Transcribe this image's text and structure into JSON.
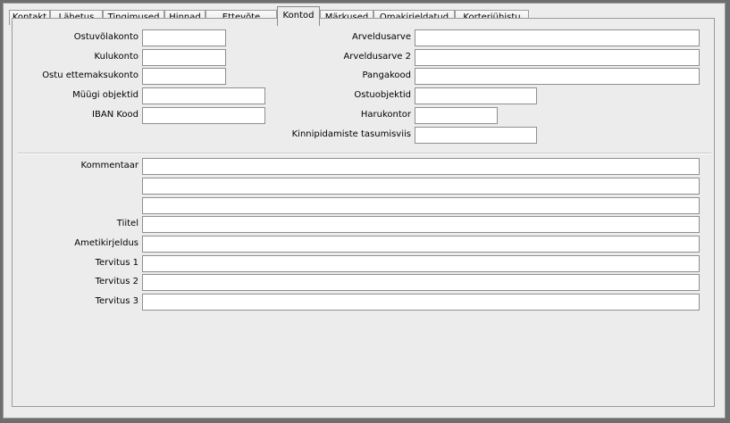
{
  "tabs": [
    {
      "label": "Kontakt"
    },
    {
      "label": "Lähetus"
    },
    {
      "label": "Tingimused"
    },
    {
      "label": "Hinnad"
    },
    {
      "label": "Ettevõte"
    },
    {
      "label": "Kontod",
      "active": true
    },
    {
      "label": "Märkused"
    },
    {
      "label": "Omakirjeldatud"
    },
    {
      "label": "Korteriühistu"
    }
  ],
  "left_fields": [
    {
      "label": "Ostuvõlakonto",
      "value": ""
    },
    {
      "label": "Kulukonto",
      "value": ""
    },
    {
      "label": "Ostu ettemaksukonto",
      "value": ""
    },
    {
      "label": "Müügi objektid",
      "value": ""
    },
    {
      "label": "IBAN Kood",
      "value": ""
    }
  ],
  "right_fields": [
    {
      "label": "Arveldusarve",
      "value": ""
    },
    {
      "label": "Arveldusarve 2",
      "value": ""
    },
    {
      "label": "Pangakood",
      "value": ""
    },
    {
      "label": "Ostuobjektid",
      "value": ""
    },
    {
      "label": "Harukontor",
      "value": ""
    },
    {
      "label": "Kinnipidamiste tasumisviis",
      "value": ""
    }
  ],
  "comment": {
    "label": "Kommentaar",
    "lines": [
      "",
      "",
      ""
    ]
  },
  "bottom_fields": [
    {
      "label": "Tiitel",
      "value": ""
    },
    {
      "label": "Ametikirjeldus",
      "value": ""
    },
    {
      "label": "Tervitus 1",
      "value": ""
    },
    {
      "label": "Tervitus 2",
      "value": ""
    },
    {
      "label": "Tervitus 3",
      "value": ""
    }
  ]
}
